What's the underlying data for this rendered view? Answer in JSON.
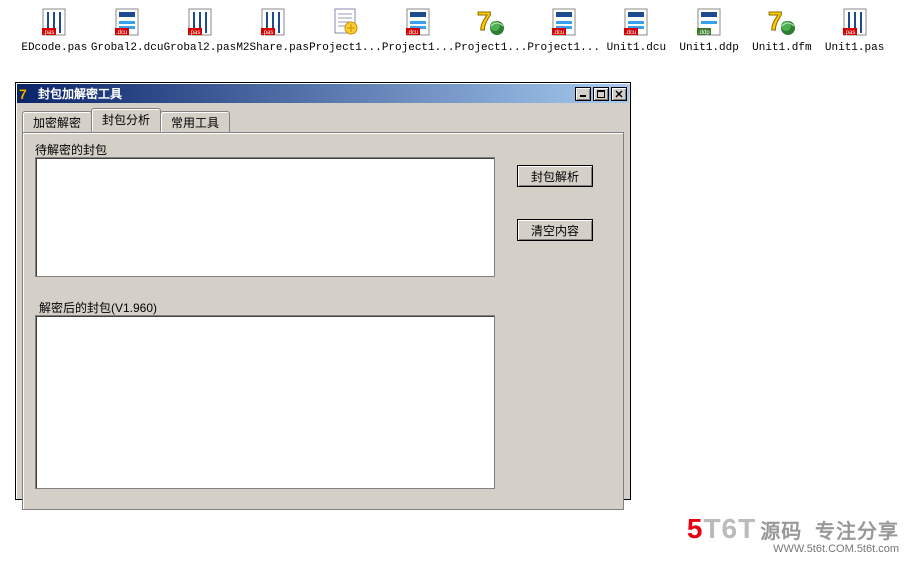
{
  "desktop": {
    "icons": [
      {
        "label": "EDcode.pas",
        "kind": "pas"
      },
      {
        "label": "Grobal2.dcu",
        "kind": "dcu"
      },
      {
        "label": "Grobal2.pas",
        "kind": "pas"
      },
      {
        "label": "M2Share.pas",
        "kind": "pas"
      },
      {
        "label": "Project1...",
        "kind": "note"
      },
      {
        "label": "Project1...",
        "kind": "dcu"
      },
      {
        "label": "Project1...",
        "kind": "delphi"
      },
      {
        "label": "Project1...",
        "kind": "dcu"
      },
      {
        "label": "Unit1.dcu",
        "kind": "dcu"
      },
      {
        "label": "Unit1.ddp",
        "kind": "ddp"
      },
      {
        "label": "Unit1.dfm",
        "kind": "delphi"
      },
      {
        "label": "Unit1.pas",
        "kind": "pas"
      }
    ]
  },
  "window": {
    "title": "封包加解密工具",
    "tabs": [
      "加密解密",
      "封包分析",
      "常用工具"
    ],
    "active_tab_index": 1,
    "group1_label": "待解密的封包",
    "group2_label": "解密后的封包(V1.960)",
    "textarea1_value": "",
    "textarea2_value": "",
    "button_parse": "封包解析",
    "button_clear": "清空内容",
    "controls": {
      "min": "_",
      "max": "□",
      "close": "×"
    }
  },
  "watermark": {
    "logo_plain": "5T6T",
    "logo_cn": "源码",
    "tagline": "专注分享",
    "url": "WWW.5t6t.COM.5t6t.com"
  }
}
